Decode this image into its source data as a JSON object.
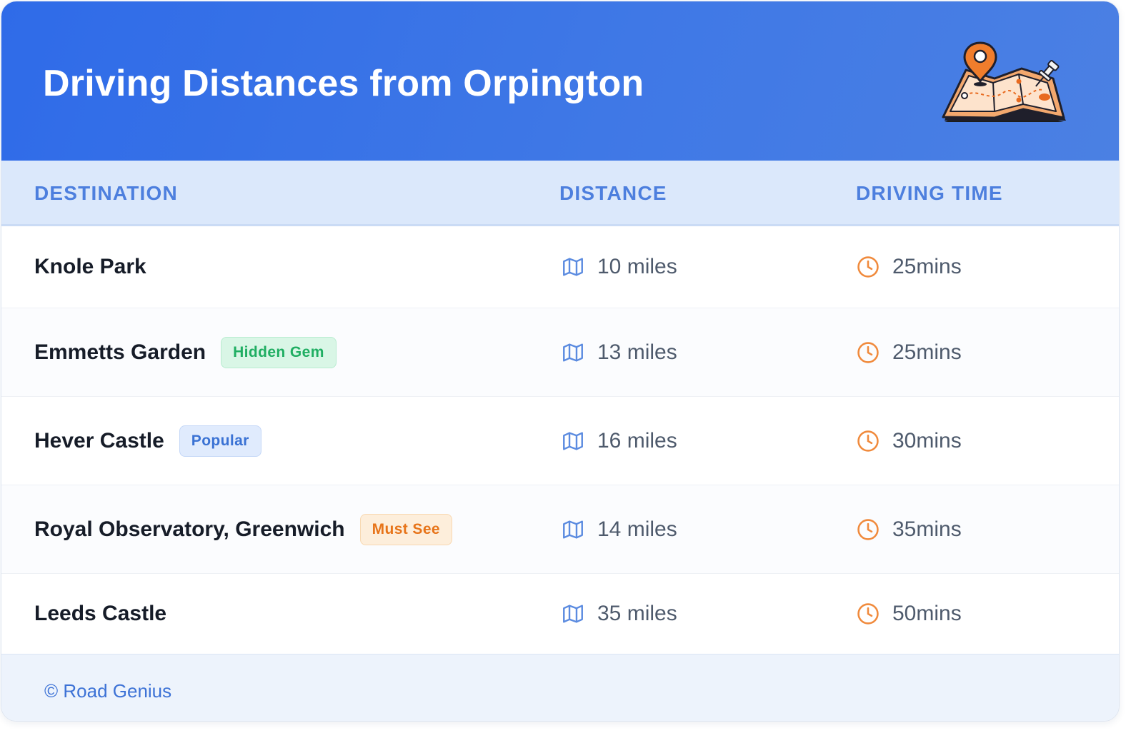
{
  "header": {
    "title": "Driving Distances from Orpington",
    "illustration_icon": "map-with-pin-icon"
  },
  "columns": {
    "destination": "DESTINATION",
    "distance": "DISTANCE",
    "driving_time": "DRIVING TIME"
  },
  "rows": [
    {
      "destination": "Knole Park",
      "badge": "",
      "distance": "10 miles",
      "time": "25mins"
    },
    {
      "destination": "Emmetts Garden",
      "badge": "Hidden Gem",
      "badge_style": "green",
      "distance": "13 miles",
      "time": "25mins"
    },
    {
      "destination": "Hever Castle",
      "badge": "Popular",
      "badge_style": "blue",
      "distance": "16 miles",
      "time": "30mins"
    },
    {
      "destination": "Royal Observatory, Greenwich",
      "badge": "Must See",
      "badge_style": "orange",
      "distance": "14 miles",
      "time": "35mins"
    },
    {
      "destination": "Leeds Castle",
      "badge": "",
      "distance": "35 miles",
      "time": "50mins"
    }
  ],
  "icons": {
    "distance": "map-icon",
    "time": "clock-icon"
  },
  "footer": {
    "credit": "© Road Genius"
  },
  "colors": {
    "header_gradient_start": "#2f6be8",
    "header_gradient_end": "#4b80e3",
    "column_header_bg": "#dbe8fb",
    "column_header_text": "#4d7fde",
    "distance_icon": "#5b8be0",
    "time_icon": "#f08a3c",
    "badge_green": "#1fae62",
    "badge_blue": "#3a72d4",
    "badge_orange": "#e77419"
  }
}
